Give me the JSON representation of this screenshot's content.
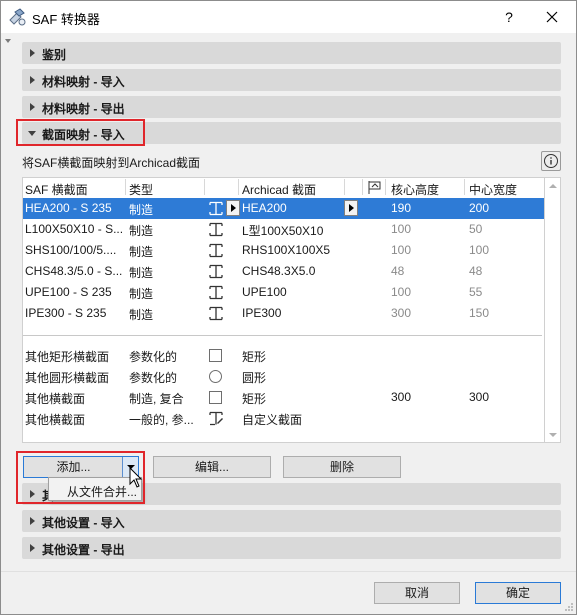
{
  "window": {
    "title": "SAF 转换器",
    "help_label": "?"
  },
  "sections": {
    "identification": "鉴别",
    "material_import": "材料映射 - 导入",
    "material_export": "材料映射 - 导出",
    "profile_import": "截面映射 - 导入",
    "hidden_partial": "其",
    "other_import": "其他设置 - 导入",
    "other_export": "其他设置 - 导出"
  },
  "description": "将SAF横截面映射到Archicad截面",
  "table": {
    "headers": {
      "saf_profile": "SAF 横截面",
      "type": "类型",
      "archicad_profile": "Archicad 截面",
      "core_height": "核心高度",
      "center_width": "中心宽度"
    },
    "rows": [
      {
        "saf": "HEA200 - S 235",
        "type": "制造",
        "archicad": "HEA200",
        "core_height": "190",
        "center_width": "200",
        "selected": true
      },
      {
        "saf": "L100X50X10 - S...",
        "type": "制造",
        "archicad": "L型100X50X10",
        "core_height": "100",
        "center_width": "50",
        "selected": false
      },
      {
        "saf": "SHS100/100/5....",
        "type": "制造",
        "archicad": "RHS100X100X5",
        "core_height": "100",
        "center_width": "100",
        "selected": false
      },
      {
        "saf": "CHS48.3/5.0 - S...",
        "type": "制造",
        "archicad": "CHS48.3X5.0",
        "core_height": "48",
        "center_width": "48",
        "selected": false
      },
      {
        "saf": "UPE100 - S 235",
        "type": "制造",
        "archicad": "UPE100",
        "core_height": "100",
        "center_width": "55",
        "selected": false
      },
      {
        "saf": "IPE300 - S 235",
        "type": "制造",
        "archicad": "IPE300",
        "core_height": "300",
        "center_width": "150",
        "selected": false
      }
    ],
    "generic_rows": [
      {
        "saf": "其他矩形横截面",
        "type": "参数化的",
        "archicad": "矩形",
        "core_height": "",
        "center_width": ""
      },
      {
        "saf": "其他圆形横截面",
        "type": "参数化的",
        "archicad": "圆形",
        "core_height": "",
        "center_width": ""
      },
      {
        "saf": "其他横截面",
        "type": "制造, 复合",
        "archicad": "矩形",
        "core_height": "300",
        "center_width": "300"
      },
      {
        "saf": "其他横截面",
        "type": "一般的, 参...",
        "archicad": "自定义截面",
        "core_height": "",
        "center_width": ""
      }
    ]
  },
  "buttons": {
    "add": "添加...",
    "edit": "编辑...",
    "delete": "删除",
    "cancel": "取消",
    "ok": "确定"
  },
  "add_menu": {
    "items": [
      "从文件合并..."
    ]
  },
  "colors": {
    "selection": "#2e7bd6",
    "highlight_border": "#e0262b",
    "section_bar": "#d9d9d9"
  },
  "icons": {
    "app": "saf-converter-icon",
    "beam": "i-beam-profile-icon",
    "custom_profile": "custom-profile-icon",
    "column_header": "profile-flag-icon"
  }
}
